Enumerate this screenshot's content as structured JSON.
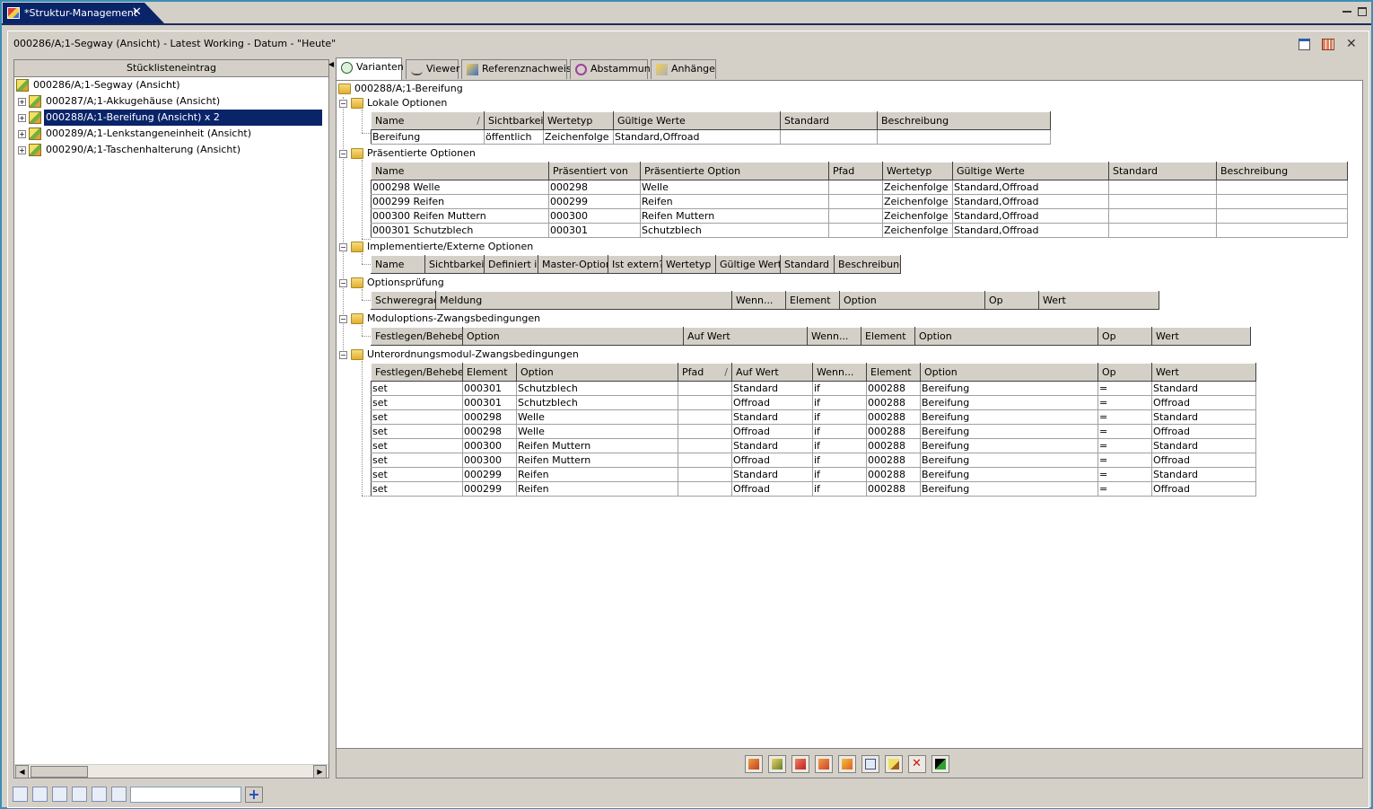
{
  "editor_tab": {
    "title": "*Struktur-Management"
  },
  "panel": {
    "title": "000286/A;1-Segway (Ansicht) - Latest Working - Datum - \"Heute\""
  },
  "left": {
    "header": "Stücklisteneintrag",
    "root": "000286/A;1-Segway (Ansicht)",
    "items": [
      {
        "label": "000287/A;1-Akkugehäuse (Ansicht)"
      },
      {
        "label": "000288/A;1-Bereifung (Ansicht) x 2"
      },
      {
        "label": "000289/A;1-Lenkstangeneinheit (Ansicht)"
      },
      {
        "label": "000290/A;1-Taschenhalterung (Ansicht)"
      }
    ]
  },
  "tabs": [
    "Varianten",
    "Viewer",
    "Referenznachweis",
    "Abstammung",
    "Anhänge"
  ],
  "content": {
    "root": "000288/A;1-Bereifung",
    "lokale": {
      "title": "Lokale Optionen",
      "headers": [
        "Name",
        "Sichtbarkeit",
        "Wertetyp",
        "Gültige Werte",
        "Standard",
        "Beschreibung"
      ],
      "rows": [
        [
          "Bereifung",
          "öffentlich",
          "Zeichenfolge",
          "Standard,Offroad",
          "",
          ""
        ]
      ]
    },
    "praesentierte": {
      "title": "Präsentierte Optionen",
      "headers": [
        "Name",
        "Präsentiert von",
        "Präsentierte Option",
        "Pfad",
        "Wertetyp",
        "Gültige Werte",
        "Standard",
        "Beschreibung"
      ],
      "rows": [
        [
          "000298 Welle",
          "000298",
          "Welle",
          "",
          "Zeichenfolge",
          "Standard,Offroad",
          "",
          ""
        ],
        [
          "000299 Reifen",
          "000299",
          "Reifen",
          "",
          "Zeichenfolge",
          "Standard,Offroad",
          "",
          ""
        ],
        [
          "000300 Reifen Muttern",
          "000300",
          "Reifen Muttern",
          "",
          "Zeichenfolge",
          "Standard,Offroad",
          "",
          ""
        ],
        [
          "000301 Schutzblech",
          "000301",
          "Schutzblech",
          "",
          "Zeichenfolge",
          "Standard,Offroad",
          "",
          ""
        ]
      ]
    },
    "implementierte": {
      "title": "Implementierte/Externe Optionen",
      "headers": [
        "Name",
        "Sichtbarkeit",
        "Definiert in",
        "Master-Option",
        "Ist extern?",
        "Wertetyp",
        "Gültige Werte",
        "Standard",
        "Beschreibung"
      ]
    },
    "pruefung": {
      "title": "Optionsprüfung",
      "headers": [
        "Schweregrad",
        "Meldung",
        "Wenn...",
        "Element",
        "Option",
        "Op",
        "Wert"
      ]
    },
    "modul": {
      "title": "Moduloptions-Zwangsbedingungen",
      "headers": [
        "Festlegen/Beheben",
        "Option",
        "Auf Wert",
        "Wenn...",
        "Element",
        "Option",
        "Op",
        "Wert"
      ]
    },
    "unter": {
      "title": "Unterordnungsmodul-Zwangsbedingungen",
      "headers": [
        "Festlegen/Beheben",
        "Element",
        "Option",
        "Pfad",
        "Auf Wert",
        "Wenn...",
        "Element",
        "Option",
        "Op",
        "Wert"
      ],
      "rows": [
        [
          "set",
          "000301",
          "Schutzblech",
          "",
          "Standard",
          "if",
          "000288",
          "Bereifung",
          "=",
          "Standard"
        ],
        [
          "set",
          "000301",
          "Schutzblech",
          "",
          "Offroad",
          "if",
          "000288",
          "Bereifung",
          "=",
          "Offroad"
        ],
        [
          "set",
          "000298",
          "Welle",
          "",
          "Standard",
          "if",
          "000288",
          "Bereifung",
          "=",
          "Standard"
        ],
        [
          "set",
          "000298",
          "Welle",
          "",
          "Offroad",
          "if",
          "000288",
          "Bereifung",
          "=",
          "Offroad"
        ],
        [
          "set",
          "000300",
          "Reifen Muttern",
          "",
          "Standard",
          "if",
          "000288",
          "Bereifung",
          "=",
          "Standard"
        ],
        [
          "set",
          "000300",
          "Reifen Muttern",
          "",
          "Offroad",
          "if",
          "000288",
          "Bereifung",
          "=",
          "Offroad"
        ],
        [
          "set",
          "000299",
          "Reifen",
          "",
          "Standard",
          "if",
          "000288",
          "Bereifung",
          "=",
          "Standard"
        ],
        [
          "set",
          "000299",
          "Reifen",
          "",
          "Offroad",
          "if",
          "000288",
          "Bereifung",
          "=",
          "Offroad"
        ]
      ]
    }
  },
  "sort_marker": "/",
  "bottom_search": {
    "value": ""
  }
}
